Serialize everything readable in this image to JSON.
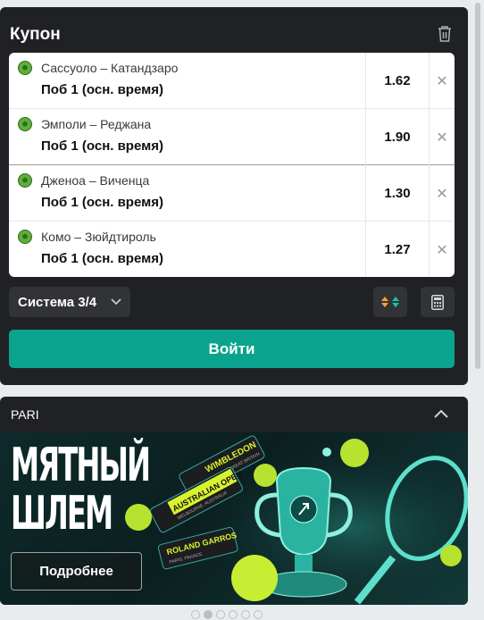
{
  "coupon": {
    "title": "Купон",
    "bets": [
      {
        "match": "Сассуоло – Катандзаро",
        "market": "Поб 1 (осн. время)",
        "odds": "1.62"
      },
      {
        "match": "Эмполи – Реджана",
        "market": "Поб 1 (осн. время)",
        "odds": "1.90"
      },
      {
        "match": "Дженоа – Виченца",
        "market": "Поб 1 (осн. время)",
        "odds": "1.30"
      },
      {
        "match": "Комо – Зюйдтироль",
        "market": "Поб 1 (осн. время)",
        "odds": "1.27"
      }
    ],
    "system_label": "Система 3/4",
    "login_label": "Войти"
  },
  "pari": {
    "title": "PARI",
    "banner": {
      "headline_line1": "МЯТНЫЙ",
      "headline_line2": "ШЛЕМ",
      "tickets": [
        "WIMBLEDON",
        "AUSTRALIAN OPEN",
        "ROLAND GARROS"
      ],
      "ticket_subs": [
        "LONDON, GREAT BRITAIN",
        "MELBOURNE, AUSTRALIA",
        "PARIS, FRANCE"
      ],
      "more_label": "Подробнее"
    }
  },
  "carousel": {
    "total": 6,
    "active": 1
  },
  "colors": {
    "accent": "#0aa48e",
    "panel": "#202124",
    "ball": "#5fae3b"
  },
  "icons": [
    "trash-icon",
    "soccer-ball-icon",
    "close-icon",
    "chevron-down-icon",
    "sort-arrows-icon",
    "calculator-icon",
    "chevron-up-icon"
  ]
}
